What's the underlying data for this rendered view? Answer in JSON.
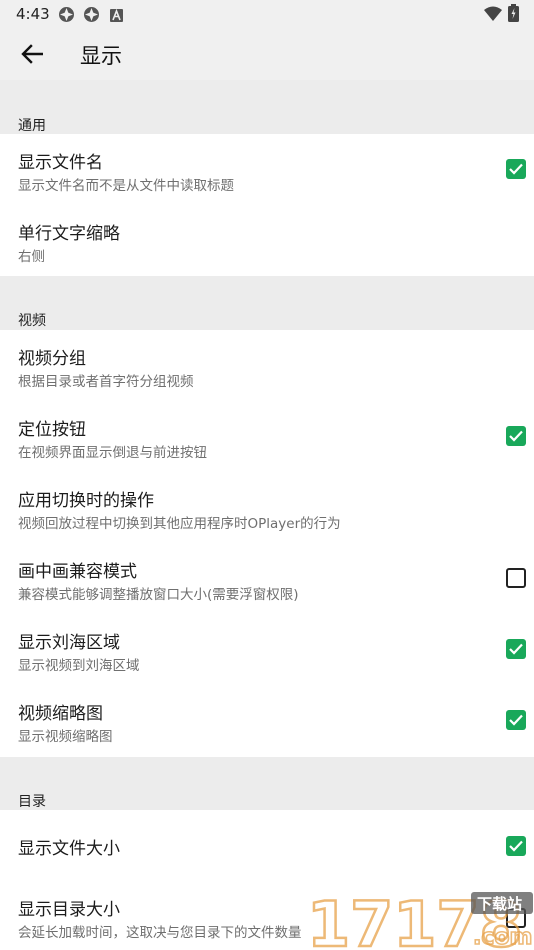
{
  "status": {
    "time": "4:43"
  },
  "app_bar": {
    "title": "显示"
  },
  "sections": {
    "general": {
      "header": "通用",
      "items": [
        {
          "title": "显示文件名",
          "subtitle": "显示文件名而不是从文件中读取标题",
          "checked": true
        },
        {
          "title": "单行文字缩略",
          "subtitle": "右侧"
        }
      ]
    },
    "video": {
      "header": "视频",
      "items": [
        {
          "title": "视频分组",
          "subtitle": "根据目录或者首字符分组视频"
        },
        {
          "title": "定位按钮",
          "subtitle": "在视频界面显示倒退与前进按钮",
          "checked": true
        },
        {
          "title": "应用切换时的操作",
          "subtitle": "视频回放过程中切换到其他应用程序时OPlayer的行为"
        },
        {
          "title": "画中画兼容模式",
          "subtitle": "兼容模式能够调整播放窗口大小(需要浮窗权限)",
          "checked": false
        },
        {
          "title": "显示刘海区域",
          "subtitle": "显示视频到刘海区域",
          "checked": true
        },
        {
          "title": "视频缩略图",
          "subtitle": "显示视频缩略图",
          "checked": true
        }
      ]
    },
    "directory": {
      "header": "目录",
      "items": [
        {
          "title": "显示文件大小",
          "checked": true
        },
        {
          "title": "显示目录大小",
          "subtitle": "会延长加载时间，这取决与您目录下的文件数量",
          "checked": false
        }
      ]
    }
  },
  "watermark": {
    "text": "17178",
    "badge": "下载站",
    "suffix": ".com"
  },
  "colors": {
    "accent": "#19a85a",
    "background": "#ececec",
    "surface": "#ffffff"
  }
}
